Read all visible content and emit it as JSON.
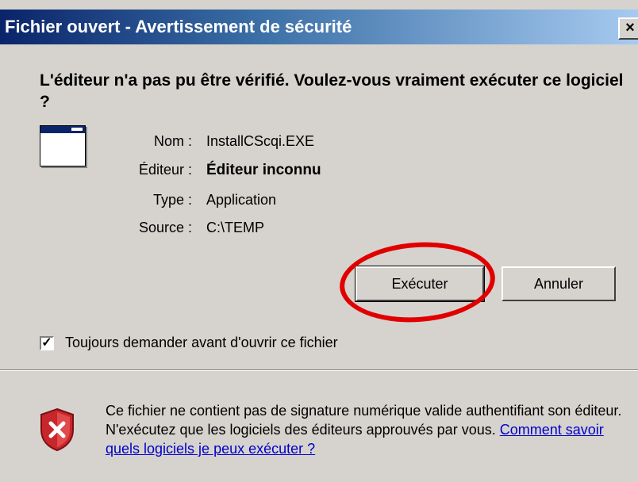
{
  "window": {
    "title": "Fichier ouvert - Avertissement de sécurité",
    "close_glyph": "×"
  },
  "heading": "L'éditeur n'a pas pu être vérifié. Voulez-vous vraiment exécuter ce logiciel ?",
  "file_info": {
    "name_label": "Nom :",
    "name_value": "InstallCScqi.EXE",
    "publisher_label": "Éditeur :",
    "publisher_value": "Éditeur inconnu",
    "type_label": "Type :",
    "type_value": "Application",
    "source_label": "Source :",
    "source_value": "C:\\TEMP"
  },
  "buttons": {
    "run": "Exécuter",
    "cancel": "Annuler"
  },
  "checkbox": {
    "label": "Toujours demander avant d'ouvrir ce fichier",
    "checked": true,
    "mark": "✓"
  },
  "info": {
    "text": "Ce fichier ne contient pas de signature numérique valide authentifiant son éditeur. N'exécutez que les logiciels des éditeurs approuvés par vous.",
    "link": "Comment savoir quels logiciels je peux exécuter ?"
  },
  "icons": {
    "app": "application-window-icon",
    "shield": "shield-warning-icon"
  },
  "colors": {
    "highlight": "#e00000",
    "link": "#0000cc",
    "titlebar_start": "#0a246a",
    "titlebar_end": "#a6caf0"
  }
}
